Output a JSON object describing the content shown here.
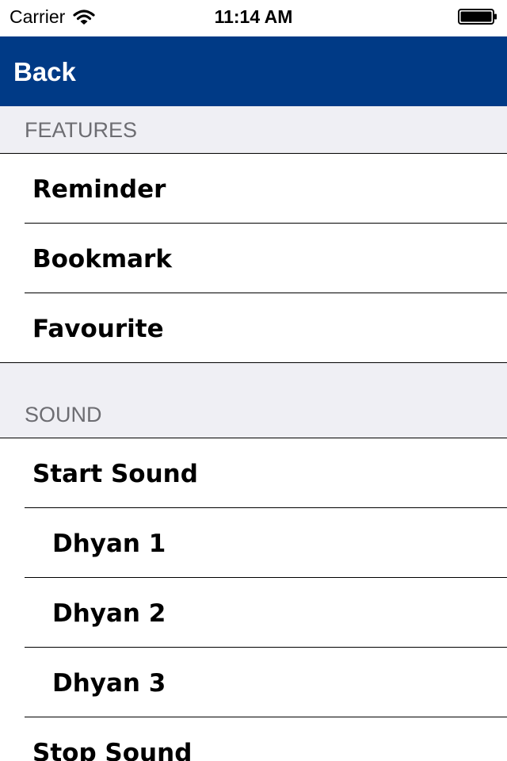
{
  "status_bar": {
    "carrier": "Carrier",
    "time": "11:14 AM"
  },
  "nav": {
    "back_label": "Back"
  },
  "sections": [
    {
      "header": "FEATURES",
      "items": [
        "Reminder",
        "Bookmark",
        "Favourite"
      ]
    },
    {
      "header": "SOUND",
      "items": [
        "Start Sound",
        "Dhyan 1",
        "Dhyan 2",
        "Dhyan 3",
        "Stop Sound"
      ]
    }
  ],
  "colors": {
    "nav_bar": "#003a86",
    "section_bg": "#efeff4",
    "section_text": "#6d6d72"
  }
}
